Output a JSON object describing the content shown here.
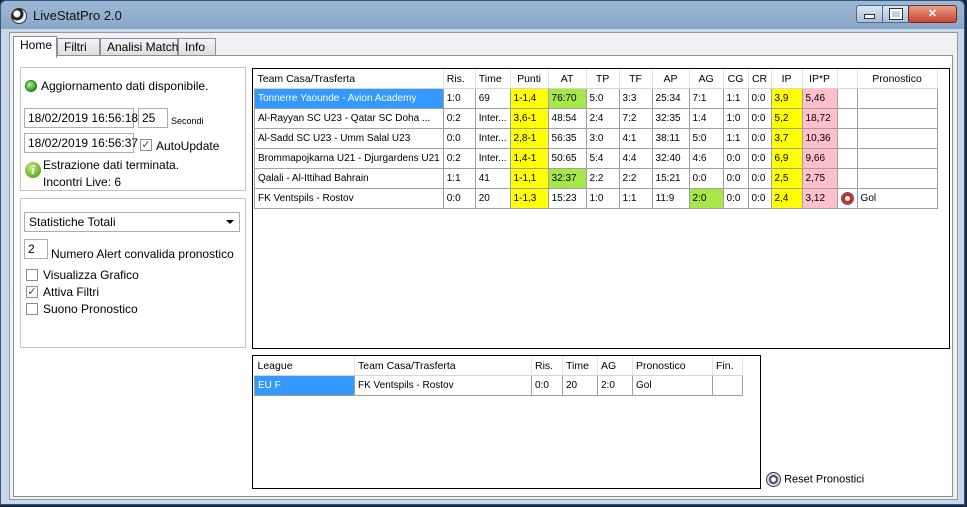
{
  "window": {
    "title": "LiveStatPro 2.0",
    "minimize_glyph": "minimize-icon",
    "maximize_glyph": "maximize-icon",
    "close_glyph": "✕"
  },
  "tabs": [
    {
      "label": "Home"
    },
    {
      "label": "Filtri"
    },
    {
      "label": "Analisi Match"
    },
    {
      "label": "Info"
    }
  ],
  "status": {
    "update_text": "Aggiornamento dati disponibile.",
    "date_from": "18/02/2019 16:56:18",
    "seconds_value": "25",
    "seconds_label": "Secondi",
    "date_to": "18/02/2019 16:56:37",
    "autoupdate_label": "AutoUpdate",
    "autoupdate_checked": true,
    "extraction_text": "Estrazione dati terminata.",
    "live_text": "Incontri Live: 6"
  },
  "options": {
    "stat_select": "Statistiche Totali",
    "alert_value": "2",
    "alert_label": "Numero Alert convalida pronostico",
    "chk_grafico": "Visualizza Grafico",
    "chk_grafico_checked": false,
    "chk_filtri": "Attiva Filtri",
    "chk_filtri_checked": true,
    "chk_suono": "Suono Pronostico",
    "chk_suono_checked": false
  },
  "matches": {
    "columns": [
      "Team Casa/Trasferta",
      "Ris.",
      "Time",
      "Punti",
      "AT",
      "TP",
      "TF",
      "AP",
      "AG",
      "CG",
      "CR",
      "IP",
      "IP*P",
      "",
      "Pronostico"
    ],
    "rows": [
      [
        "Tonnerre Yaounde - Avion Academy",
        "1:0",
        "69",
        "1-1,4",
        "76:70",
        "5:0",
        "3:3",
        "25:34",
        "7:1",
        "1:1",
        "0:0",
        "3,9",
        "5,46",
        "",
        ""
      ],
      [
        "Al-Rayyan SC U23 - Qatar SC Doha ...",
        "0:2",
        "Inter...",
        "3,6-1",
        "48:54",
        "2:4",
        "7:2",
        "32:35",
        "1:4",
        "1:0",
        "0:0",
        "5,2",
        "18,72",
        "",
        ""
      ],
      [
        "Al-Sadd SC U23 - Umm Salal U23",
        "0:0",
        "Inter...",
        "2,8-1",
        "56:35",
        "3:0",
        "4:1",
        "38:11",
        "5:0",
        "1:1",
        "0:0",
        "3,7",
        "10,36",
        "",
        ""
      ],
      [
        "Brommapojkarna U21 - Djurgardens U21",
        "0:2",
        "Inter...",
        "1,4-1",
        "50:65",
        "5:4",
        "4:4",
        "32:40",
        "4:6",
        "0:0",
        "0:0",
        "6,9",
        "9,66",
        "",
        ""
      ],
      [
        "Qalali - Al-Ittihad Bahrain",
        "1:1",
        "41",
        "1-1,1",
        "32:37",
        "2:2",
        "2:2",
        "15:21",
        "0:0",
        "0:0",
        "0:0",
        "2,5",
        "2,75",
        "",
        ""
      ],
      [
        "FK Ventspils - Rostov",
        "0:0",
        "20",
        "1-1,3",
        "15:23",
        "1:0",
        "1:1",
        "11:9",
        "2:0",
        "0:0",
        "0:0",
        "2,4",
        "3,12",
        "ball-icon",
        "Gol"
      ]
    ],
    "highlight_colors": {
      "yellow": "#ffff00",
      "green": "#a6e84a",
      "pink": "#ffc0cb",
      "selection": "#3399ff"
    }
  },
  "alerts": {
    "columns": [
      "League",
      "Team Casa/Trasferta",
      "Ris.",
      "Time",
      "AG",
      "Pronostico",
      "Fin."
    ],
    "rows": [
      [
        "EU F",
        "FK Ventspils - Rostov",
        "0:0",
        "20",
        "2:0",
        "Gol",
        ""
      ]
    ]
  },
  "reset_label": "Reset Pronostici"
}
